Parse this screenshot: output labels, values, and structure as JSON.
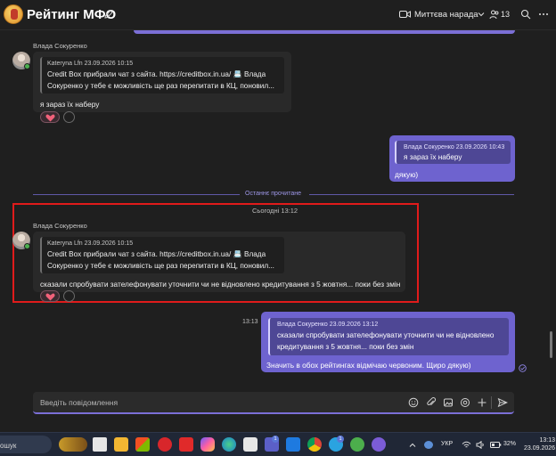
{
  "header": {
    "title": "Рейтинг МФО",
    "meet_label": "Миттєва нарада",
    "people_count": "13"
  },
  "messages": {
    "m1": {
      "sender": "Влада Сокуренко",
      "quote_author": "Kateryna Lfn   23.09.2026 10:15",
      "quote_line1": "Credit Box прибрали чат з сайта. https://creditbox.in.ua/ 📇 Влада",
      "quote_line2": "Сокуренко у тебе є можливість ще раз перепитати в КЦ, поновил...",
      "text": "я зараз їх наберу"
    },
    "m2": {
      "quote_author": "Влада Сокуренко   23.09.2026 10:43",
      "quote_line1": "я зараз їх наберу",
      "text": "дякую)"
    },
    "divider": "Останнє прочитане",
    "today": "Сьогодні 13:12",
    "m3": {
      "sender": "Влада Сокуренко",
      "quote_author": "Kateryna Lfn   23.09.2026 10:15",
      "quote_line1": "Credit Box прибрали чат з сайта. https://creditbox.in.ua/ 📇 Влада",
      "quote_line2": "Сокуренко у тебе є можливість ще раз перепитати в КЦ, поновил...",
      "text": "сказали спробувати зателефонувати уточнити чи не відновлено кредитування з 5 жовтня... поки без змін"
    },
    "m4": {
      "time": "13:13",
      "quote_author": "Влада Сокуренко   23.09.2026 13:12",
      "quote_line1": "сказали спробувати зателефонувати уточнити чи не відновлено",
      "quote_line2": "кредитування з 5 жовтня... поки без змін",
      "text": "Значить в обох рейтингах відмічаю червоним. Щиро дякую)"
    }
  },
  "composer": {
    "placeholder": "Введіть повідомлення"
  },
  "taskbar": {
    "search_text": "ошук",
    "teams_badge": "1",
    "telegram_badge": "1",
    "lang": "УКР",
    "battery": "32%",
    "time": "13:13",
    "date": "23.09.2026"
  },
  "colors": {
    "accent": "#7b6fd6",
    "outgoing_bubble": "#6e63cf",
    "incoming_bubble": "#292929",
    "highlight": "#e01b1b"
  }
}
